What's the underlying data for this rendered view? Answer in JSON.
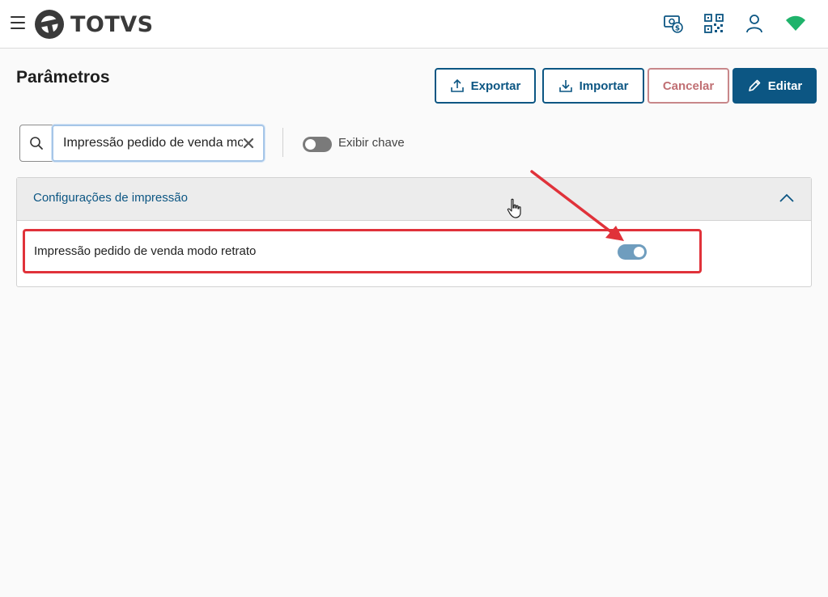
{
  "brand": {
    "name": "TOTVS"
  },
  "topbar": {
    "icons": [
      "menu-icon",
      "money-icon",
      "qr-code-icon",
      "user-icon",
      "wifi-icon"
    ]
  },
  "page": {
    "title": "Parâmetros"
  },
  "toolbar": {
    "export_label": "Exportar",
    "import_label": "Importar",
    "cancel_label": "Cancelar",
    "edit_label": "Editar"
  },
  "search": {
    "value": "Impressão pedido de venda modo retrato"
  },
  "show_key": {
    "label": "Exibir chave",
    "enabled": false
  },
  "accordion": {
    "title": "Configurações de impressão",
    "expanded": true,
    "items": [
      {
        "label": "Impressão pedido de venda modo retrato",
        "enabled": true
      }
    ]
  },
  "colors": {
    "primary": "#0c5683",
    "danger": "#c06f73",
    "highlight": "#e0323a",
    "toggle_on": "#6f9dbe",
    "wifi": "#1fb36b"
  }
}
